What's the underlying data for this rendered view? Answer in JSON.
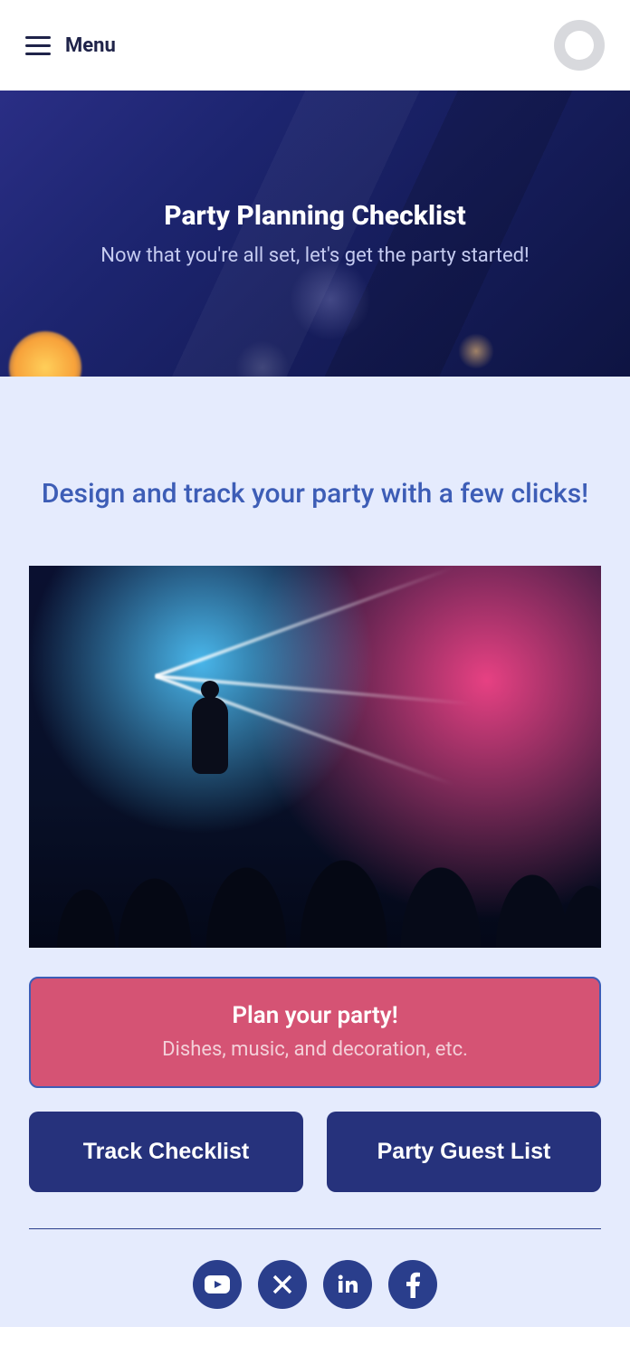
{
  "header": {
    "menu_label": "Menu"
  },
  "hero": {
    "title": "Party Planning Checklist",
    "subtitle": "Now that you're all set, let's get the party started!"
  },
  "main": {
    "heading": "Design and track your party with a few clicks!",
    "plan_button": {
      "title": "Plan your party!",
      "subtitle": "Dishes, music, and decoration, etc."
    },
    "track_button": "Track Checklist",
    "guest_button": "Party Guest List"
  },
  "social": {
    "youtube": "youtube-icon",
    "x": "x-icon",
    "linkedin": "linkedin-icon",
    "facebook": "facebook-icon"
  }
}
